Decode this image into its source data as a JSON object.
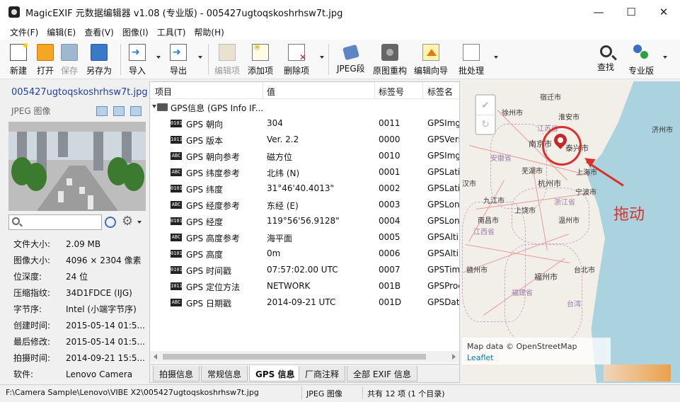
{
  "window": {
    "title": "MagicEXIF 元数据编辑器 v1.08 (专业版) - 005427ugtoqskoshrhsw7t.jpg",
    "minimize": "—",
    "maximize": "☐",
    "close": "✕"
  },
  "menu": [
    "文件(F)",
    "编辑(E)",
    "查看(V)",
    "图像(I)",
    "工具(T)",
    "帮助(H)"
  ],
  "toolbar": {
    "new": "新建",
    "open": "打开",
    "save": "保存",
    "saveas": "另存为",
    "import": "导入",
    "export": "导出",
    "edit_item": "编辑项",
    "add_item": "添加项",
    "delete_item": "删除项",
    "jpeg_segment": "JPEG段",
    "rebuild": "原图重构",
    "wizard": "编辑向导",
    "batch": "批处理",
    "search": "查找",
    "pro": "专业版"
  },
  "sidebar": {
    "filename": "005427ugtoqskoshrhsw7t.jpg",
    "kind": "JPEG 图像",
    "search_placeholder": "",
    "info": [
      {
        "k": "文件大小:",
        "v": "2.09 MB"
      },
      {
        "k": "图像大小:",
        "v": "4096 × 2304 像素"
      },
      {
        "k": "位深度:",
        "v": "24 位"
      },
      {
        "k": "压缩指纹:",
        "v": "34D1FDCE (IJG)"
      },
      {
        "k": "字节序:",
        "v": "Intel (小端字节序)"
      },
      {
        "k": "创建时间:",
        "v": "2015-05-14 01:5..."
      },
      {
        "k": "最后修改:",
        "v": "2015-05-14 01:5..."
      },
      {
        "k": "拍摄时间:",
        "v": "2014-09-21 15:5..."
      },
      {
        "k": "软件:",
        "v": "Lenovo Camera"
      }
    ]
  },
  "table": {
    "headers": [
      "项目",
      "值",
      "标签号",
      "标签名"
    ],
    "group": "GPS信息 (GPS Info IF...",
    "rows": [
      {
        "icon": "0101",
        "name": "GPS 朝向",
        "value": "304",
        "tag": "0011",
        "tagname": "GPSImg"
      },
      {
        "icon": "1011",
        "name": "GPS 版本",
        "value": "Ver. 2.2",
        "tag": "0000",
        "tagname": "GPSVers"
      },
      {
        "icon": "ABC",
        "name": "GPS 朝向参考",
        "value": "磁方位",
        "tag": "0010",
        "tagname": "GPSImg"
      },
      {
        "icon": "ABC",
        "name": "GPS 纬度参考",
        "value": "北纬 (N)",
        "tag": "0001",
        "tagname": "GPSLati"
      },
      {
        "icon": "0101",
        "name": "GPS 纬度",
        "value": "31°46'40.4013\"",
        "tag": "0002",
        "tagname": "GPSLati"
      },
      {
        "icon": "ABC",
        "name": "GPS 经度参考",
        "value": "东经 (E)",
        "tag": "0003",
        "tagname": "GPSLon"
      },
      {
        "icon": "0101",
        "name": "GPS 经度",
        "value": "119°56'56.9128\"",
        "tag": "0004",
        "tagname": "GPSLon"
      },
      {
        "icon": "ABC",
        "name": "GPS 高度参考",
        "value": "海平面",
        "tag": "0005",
        "tagname": "GPSAlti"
      },
      {
        "icon": "0101",
        "name": "GPS 高度",
        "value": "0m",
        "tag": "0006",
        "tagname": "GPSAlti"
      },
      {
        "icon": "0101",
        "name": "GPS 时间戳",
        "value": "07:57:02.00 UTC",
        "tag": "0007",
        "tagname": "GPSTim"
      },
      {
        "icon": "1011",
        "name": "GPS 定位方法",
        "value": "NETWORK",
        "tag": "001B",
        "tagname": "GPSProc"
      },
      {
        "icon": "ABC",
        "name": "GPS 日期戳",
        "value": "2014-09-21 UTC",
        "tag": "001D",
        "tagname": "GPSDat"
      }
    ]
  },
  "tabs": [
    "拍摄信息",
    "常规信息",
    "GPS 信息",
    "厂商注释",
    "全部 EXIF 信息"
  ],
  "active_tab": "GPS 信息",
  "map": {
    "cities": [
      "徐州市",
      "南京市",
      "宿迁市",
      "淮安市",
      "芜湖市",
      "杭州市",
      "九江市",
      "南昌市",
      "上饶市",
      "温州市",
      "赣州市",
      "福州市",
      "上海市",
      "台北市",
      "济州市",
      "宁波市",
      "汉市"
    ],
    "marker_label": "泰兴市",
    "provinces": [
      "安徽省",
      "江苏省",
      "浙江省",
      "江西省",
      "福建省",
      "台湾"
    ],
    "annotation": "拖动",
    "attribution": "Map data © OpenStreetMap",
    "leaflet": "Leaflet",
    "check": "✔",
    "undo": "↻"
  },
  "status": {
    "path": "F:\\Camera Sample\\Lenovo\\VIBE X2\\005427ugtoqskoshrhsw7t.jpg",
    "type": "JPEG 图像",
    "count": "共有 12 项 (1 个目录)"
  },
  "colors": {
    "accent_blue": "#1f3fa8",
    "annotation_red": "#d9302a",
    "sea": "#aad3df"
  }
}
